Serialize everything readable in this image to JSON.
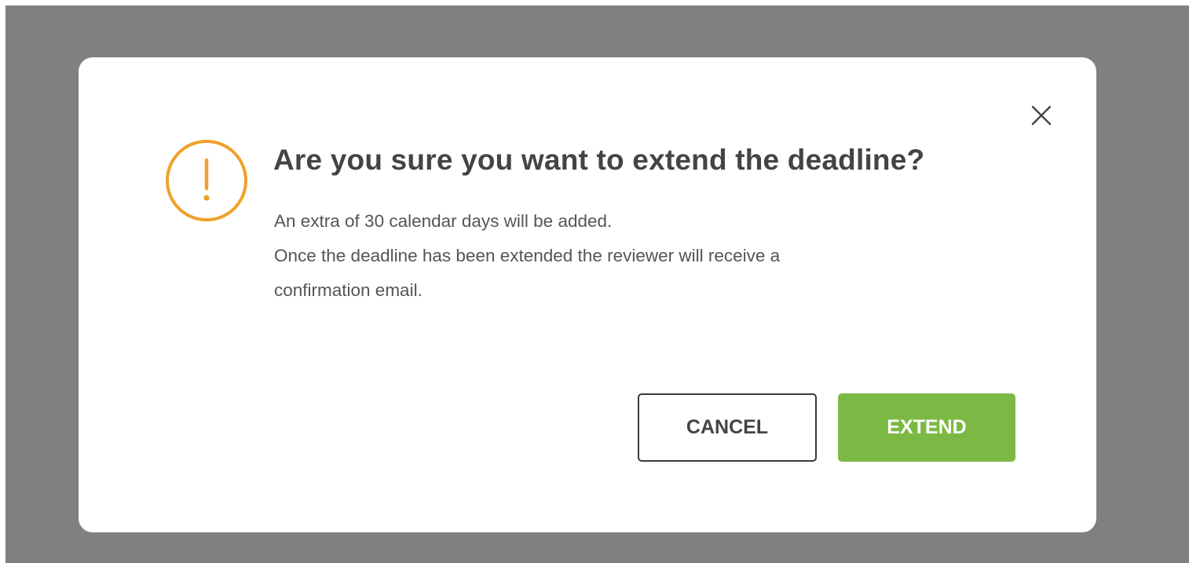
{
  "dialog": {
    "title": "Are you sure you want to extend the deadline?",
    "message_lines": [
      "An extra of 30 calendar days will be added.",
      "Once the deadline has been extended the reviewer will receive a",
      "confirmation email."
    ],
    "cancel_label": "CANCEL",
    "extend_label": "EXTEND",
    "icons": {
      "warning": "exclamation-circle-icon",
      "close": "close-icon"
    }
  },
  "colors": {
    "backdrop": "#808080",
    "warning": "#f0a02a",
    "extend_button": "#7cb944",
    "title_text": "#444444",
    "body_text": "#555555"
  }
}
